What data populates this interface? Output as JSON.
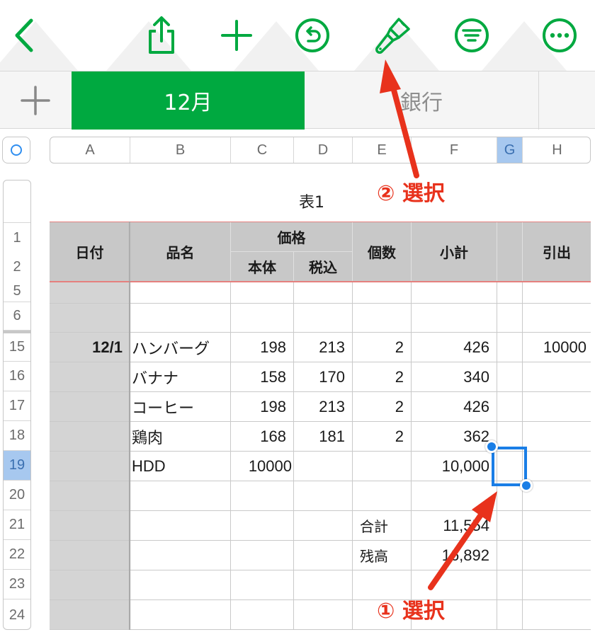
{
  "toolbar": {
    "icons": [
      "chevron-left-icon",
      "share-icon",
      "plus-icon",
      "undo-icon",
      "paintbrush-icon",
      "filter-icon",
      "more-icon"
    ],
    "accent": "#00a940"
  },
  "tabs": {
    "active_label": "12月",
    "inactive_label": "銀行"
  },
  "columns": [
    "A",
    "B",
    "C",
    "D",
    "E",
    "F",
    "G",
    "H"
  ],
  "selected_column": "G",
  "rows": [
    "1",
    "2",
    "5",
    "6",
    "15",
    "16",
    "17",
    "18",
    "19",
    "20",
    "21",
    "22",
    "23",
    "24"
  ],
  "selected_row": "19",
  "table": {
    "title": "表1",
    "headers": {
      "date": "日付",
      "item": "品名",
      "price": "価格",
      "base": "本体",
      "taxin": "税込",
      "qty": "個数",
      "subtotal": "小計",
      "withdraw": "引出"
    },
    "data_rows": [
      {
        "date": "12/1",
        "item": "ハンバーグ",
        "base": "198",
        "taxin": "213",
        "qty": "2",
        "subtotal": "426",
        "withdraw": "10000"
      },
      {
        "date": "",
        "item": "バナナ",
        "base": "158",
        "taxin": "170",
        "qty": "2",
        "subtotal": "340",
        "withdraw": ""
      },
      {
        "date": "",
        "item": "コーヒー",
        "base": "198",
        "taxin": "213",
        "qty": "2",
        "subtotal": "426",
        "withdraw": ""
      },
      {
        "date": "",
        "item": "鶏肉",
        "base": "168",
        "taxin": "181",
        "qty": "2",
        "subtotal": "362",
        "withdraw": ""
      },
      {
        "date": "",
        "item": "HDD",
        "base": "10000",
        "taxin": "",
        "qty": "",
        "subtotal": "10,000",
        "withdraw": ""
      }
    ],
    "summary": {
      "total_label": "合計",
      "total_value": "11,554",
      "balance_label": "残高",
      "balance_value": "16,892"
    }
  },
  "annotations": {
    "step1": "① 選択",
    "step2": "② 選択",
    "color": "#e8321c"
  }
}
